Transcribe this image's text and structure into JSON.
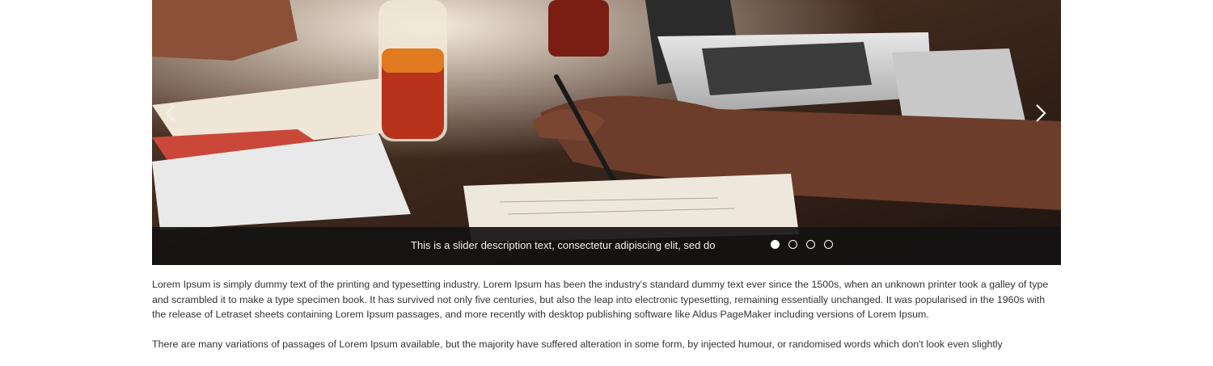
{
  "slider": {
    "caption": "This is a slider description text, consectetur adipiscing elit, sed do",
    "slides": [
      {
        "label": "slide 1",
        "active": true
      },
      {
        "label": "slide 2",
        "active": false
      },
      {
        "label": "slide 3",
        "active": false
      },
      {
        "label": "slide 4",
        "active": false
      }
    ],
    "prev_icon": "chevron-left-icon",
    "next_icon": "chevron-right-icon"
  },
  "content": {
    "paragraph_1": "Lorem Ipsum is simply dummy text of the printing and typesetting industry. Lorem Ipsum has been the industry's standard dummy text ever since the 1500s, when an unknown printer took a galley of type and scrambled it to make a type specimen book. It has survived not only five centuries, but also the leap into electronic typesetting, remaining essentially unchanged. It was popularised in the 1960s with the release of Letraset sheets containing Lorem Ipsum passages, and more recently with desktop publishing software like Aldus PageMaker including versions of Lorem Ipsum.",
    "paragraph_2": "There are many variations of passages of Lorem Ipsum available, but the majority have suffered alteration in some form, by injected humour, or randomised words which don't look even slightly"
  },
  "colors": {
    "caption_bar": "#141212",
    "caption_text": "#f2f2f2",
    "body_text": "#333333"
  }
}
